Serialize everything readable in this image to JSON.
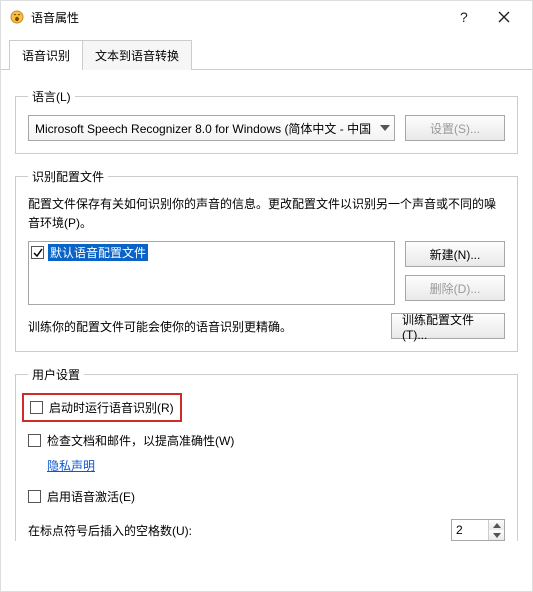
{
  "window": {
    "title": "语音属性"
  },
  "tabs": {
    "active": "语音识别",
    "other": "文本到语音转换"
  },
  "language": {
    "legend": "语言(L)",
    "selected": "Microsoft Speech Recognizer 8.0 for Windows (简体中文 - 中国",
    "settings_btn": "设置(S)..."
  },
  "profiles": {
    "legend": "识别配置文件",
    "desc": "配置文件保存有关如何识别你的声音的信息。更改配置文件以识别另一个声音或不同的噪音环境(P)。",
    "default_item": "默认语音配置文件",
    "default_checked": true,
    "new_btn": "新建(N)...",
    "delete_btn": "删除(D)...",
    "train_text": "训练你的配置文件可能会使你的语音识别更精确。",
    "train_btn": "训练配置文件(T)..."
  },
  "user": {
    "legend": "用户设置",
    "run_at_startup": "启动时运行语音识别(R)",
    "review_docs": "检查文档和邮件，以提高准确性(W)",
    "privacy_link": "隐私声明",
    "voice_activation": "启用语音激活(E)",
    "spaces_label": "在标点符号后插入的空格数(U):",
    "spaces_value": "2"
  }
}
